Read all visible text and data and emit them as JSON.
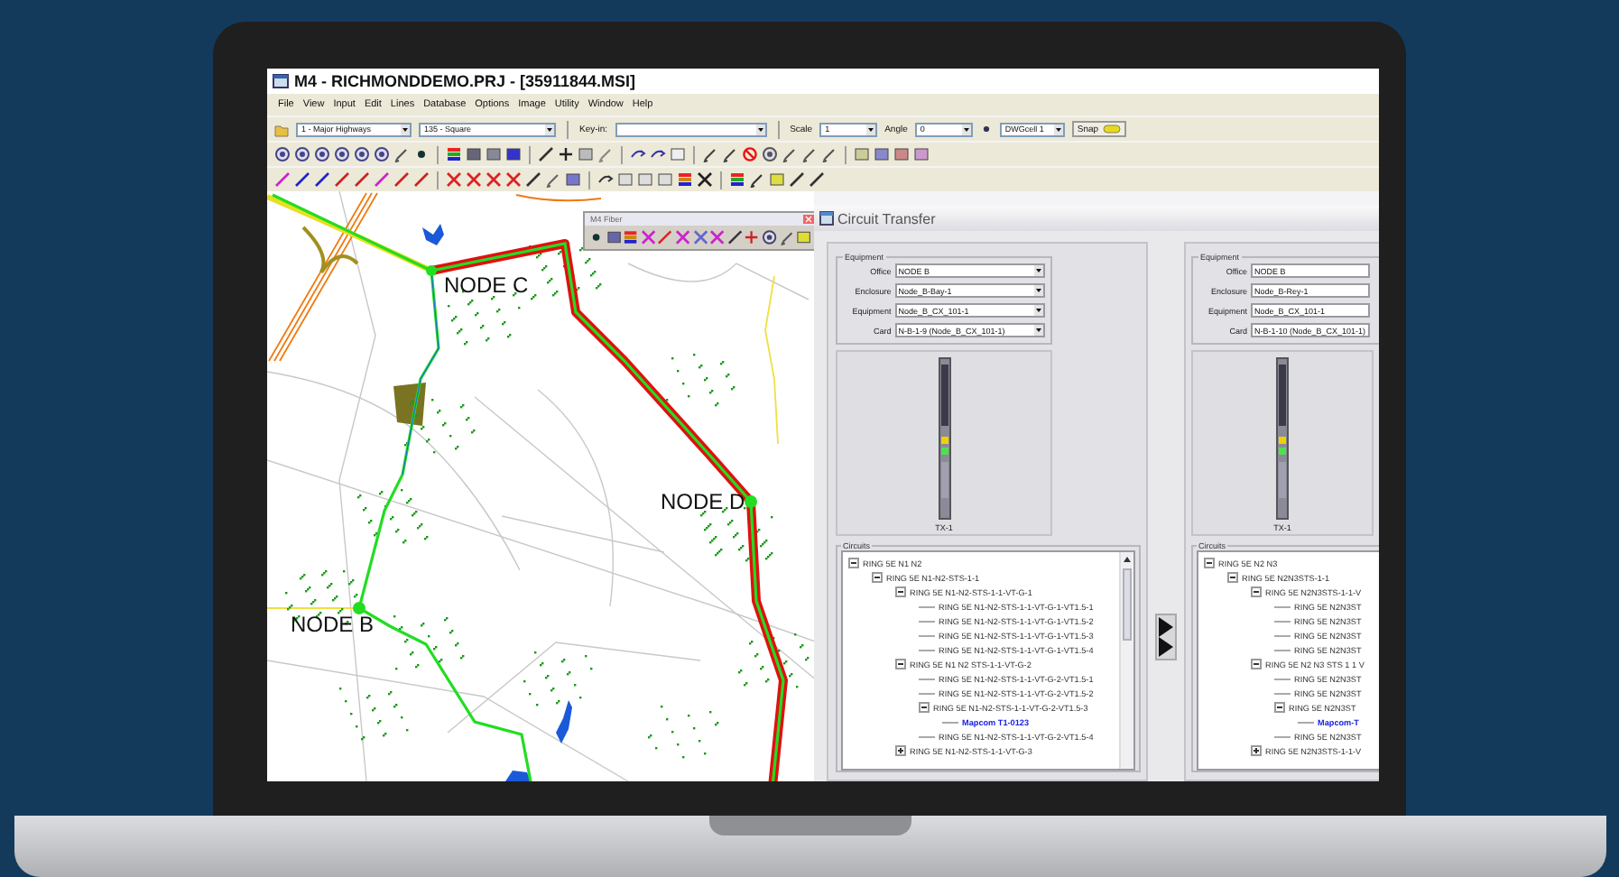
{
  "window": {
    "title": "M4 - RICHMONDDEMO.PRJ - [35911844.MSI]"
  },
  "menu": [
    "File",
    "View",
    "Input",
    "Edit",
    "Lines",
    "Database",
    "Options",
    "Image",
    "Utility",
    "Window",
    "Help"
  ],
  "toolbar": {
    "layer": "1 - Major Highways",
    "symbol": "135 - Square",
    "keyin_label": "Key-in:",
    "scale_label": "Scale",
    "scale": "1",
    "angle_label": "Angle",
    "angle": "0",
    "cell": "DWGcell 1",
    "snap_button": "Snap"
  },
  "map": {
    "labels": [
      "NODE C",
      "NODE D",
      "NODE B"
    ],
    "fiber_toolbar": {
      "title": "M4 Fiber"
    }
  },
  "circuit_transfer": {
    "title": "Circuit Transfer",
    "panels": [
      {
        "equipment_title": "Equipment",
        "fields": [
          {
            "label": "Office",
            "value": "NODE B"
          },
          {
            "label": "Enclosure",
            "value": "Node_B-Bay-1"
          },
          {
            "label": "Equipment",
            "value": "Node_B_CX_101-1"
          },
          {
            "label": "Card",
            "value": "N-B-1-9 (Node_B_CX_101-1)"
          }
        ],
        "card_label": "TX-1",
        "circuits_title": "Circuits",
        "tree": [
          {
            "text": "RING 5E N1 N2",
            "kind": "ring",
            "expanded": true,
            "children": [
              {
                "text": "RING 5E N1-N2-STS-1-1",
                "kind": "ring",
                "expanded": true,
                "children": [
                  {
                    "text": "RING 5E N1-N2-STS-1-1-VT-G-1",
                    "kind": "ring",
                    "expanded": true,
                    "children": [
                      {
                        "text": "RING 5E N1-N2-STS-1-1-VT-G-1-VT1.5-1",
                        "kind": "ring"
                      },
                      {
                        "text": "RING 5E N1-N2-STS-1-1-VT-G-1-VT1.5-2",
                        "kind": "ring"
                      },
                      {
                        "text": "RING 5E N1-N2-STS-1-1-VT-G-1-VT1.5-3",
                        "kind": "ring"
                      },
                      {
                        "text": "RING 5E N1-N2-STS-1-1-VT-G-1-VT1.5-4",
                        "kind": "ring"
                      }
                    ]
                  },
                  {
                    "text": "RING 5E N1 N2 STS-1-1-VT-G-2",
                    "kind": "ring",
                    "expanded": true,
                    "children": [
                      {
                        "text": "RING 5E N1-N2-STS-1-1-VT-G-2-VT1.5-1",
                        "kind": "ring"
                      },
                      {
                        "text": "RING 5E N1-N2-STS-1-1-VT-G-2-VT1.5-2",
                        "kind": "ring"
                      },
                      {
                        "text": "RING 5E N1-N2-STS-1-1-VT-G-2-VT1.5-3",
                        "kind": "ring",
                        "expanded": true,
                        "children": [
                          {
                            "text": "Mapcom T1-0123",
                            "kind": "circuit"
                          }
                        ]
                      },
                      {
                        "text": "RING 5E N1-N2-STS-1-1-VT-G-2-VT1.5-4",
                        "kind": "ring"
                      }
                    ]
                  },
                  {
                    "text": "RING 5E N1-N2-STS-1-1-VT-G-3",
                    "kind": "ring",
                    "expanded": false
                  }
                ]
              }
            ]
          }
        ]
      },
      {
        "equipment_title": "Equipment",
        "fields": [
          {
            "label": "Office",
            "value": "NODE B"
          },
          {
            "label": "Enclosure",
            "value": "Node_B-Rey-1"
          },
          {
            "label": "Equipment",
            "value": "Node_B_CX_101-1"
          },
          {
            "label": "Card",
            "value": "N-B-1-10 (Node_B_CX_101-1)"
          }
        ],
        "card_label": "TX-1",
        "circuits_title": "Circuits",
        "tree": [
          {
            "text": "RING 5E N2 N3",
            "kind": "ring",
            "expanded": true,
            "children": [
              {
                "text": "RING 5E N2N3STS-1-1",
                "kind": "ring",
                "expanded": true,
                "children": [
                  {
                    "text": "RING 5E N2N3STS-1-1-V",
                    "kind": "ring",
                    "expanded": true,
                    "children": [
                      {
                        "text": "RING 5E N2N3ST",
                        "kind": "ring"
                      },
                      {
                        "text": "RING 5E N2N3ST",
                        "kind": "ring"
                      },
                      {
                        "text": "RING 5E N2N3ST",
                        "kind": "ring"
                      },
                      {
                        "text": "RING 5E N2N3ST",
                        "kind": "ring"
                      }
                    ]
                  },
                  {
                    "text": "RING 5E N2 N3 STS 1 1 V",
                    "kind": "ring",
                    "expanded": true,
                    "children": [
                      {
                        "text": "RING 5E N2N3ST",
                        "kind": "ring"
                      },
                      {
                        "text": "RING 5E N2N3ST",
                        "kind": "ring"
                      },
                      {
                        "text": "RING 5E N2N3ST",
                        "kind": "ring",
                        "expanded": true,
                        "children": [
                          {
                            "text": "Mapcom-T",
                            "kind": "circuit"
                          }
                        ]
                      },
                      {
                        "text": "RING 5E N2N3ST",
                        "kind": "ring"
                      }
                    ]
                  },
                  {
                    "text": "RING 5E N2N3STS-1-1-V",
                    "kind": "ring",
                    "expanded": false
                  }
                ]
              }
            ]
          }
        ]
      }
    ]
  }
}
